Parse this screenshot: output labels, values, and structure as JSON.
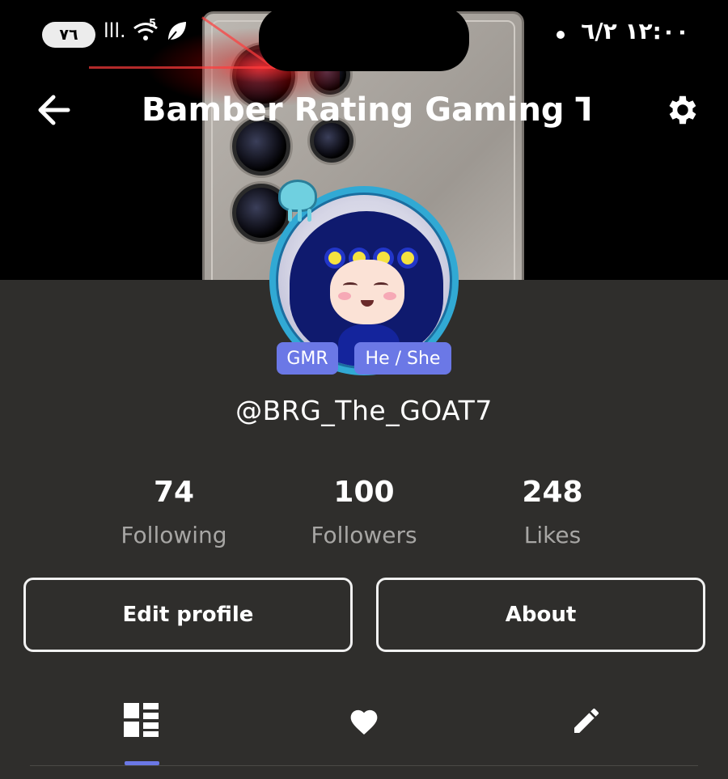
{
  "status_bar": {
    "battery": "٧٦",
    "signal": "lll.",
    "wifi_badge": "5",
    "time": "١٢:٠٠",
    "date": "٦/٢"
  },
  "header": {
    "title": "Bamber Rating Gaming The",
    "back_icon": "arrow-left-icon",
    "settings_icon": "gear-icon"
  },
  "profile": {
    "badges": [
      "GMR",
      "He / She"
    ],
    "username": "@BRG_The_GOAT7",
    "accent_color": "#6b78e6"
  },
  "stats": [
    {
      "value": "74",
      "label": "Following"
    },
    {
      "value": "100",
      "label": "Followers"
    },
    {
      "value": "248",
      "label": "Likes"
    }
  ],
  "actions": {
    "edit_profile": "Edit profile",
    "about": "About"
  },
  "tabs": [
    {
      "icon": "grid-icon",
      "selected": true
    },
    {
      "icon": "heart-icon",
      "selected": false
    },
    {
      "icon": "pencil-icon",
      "selected": false
    }
  ]
}
